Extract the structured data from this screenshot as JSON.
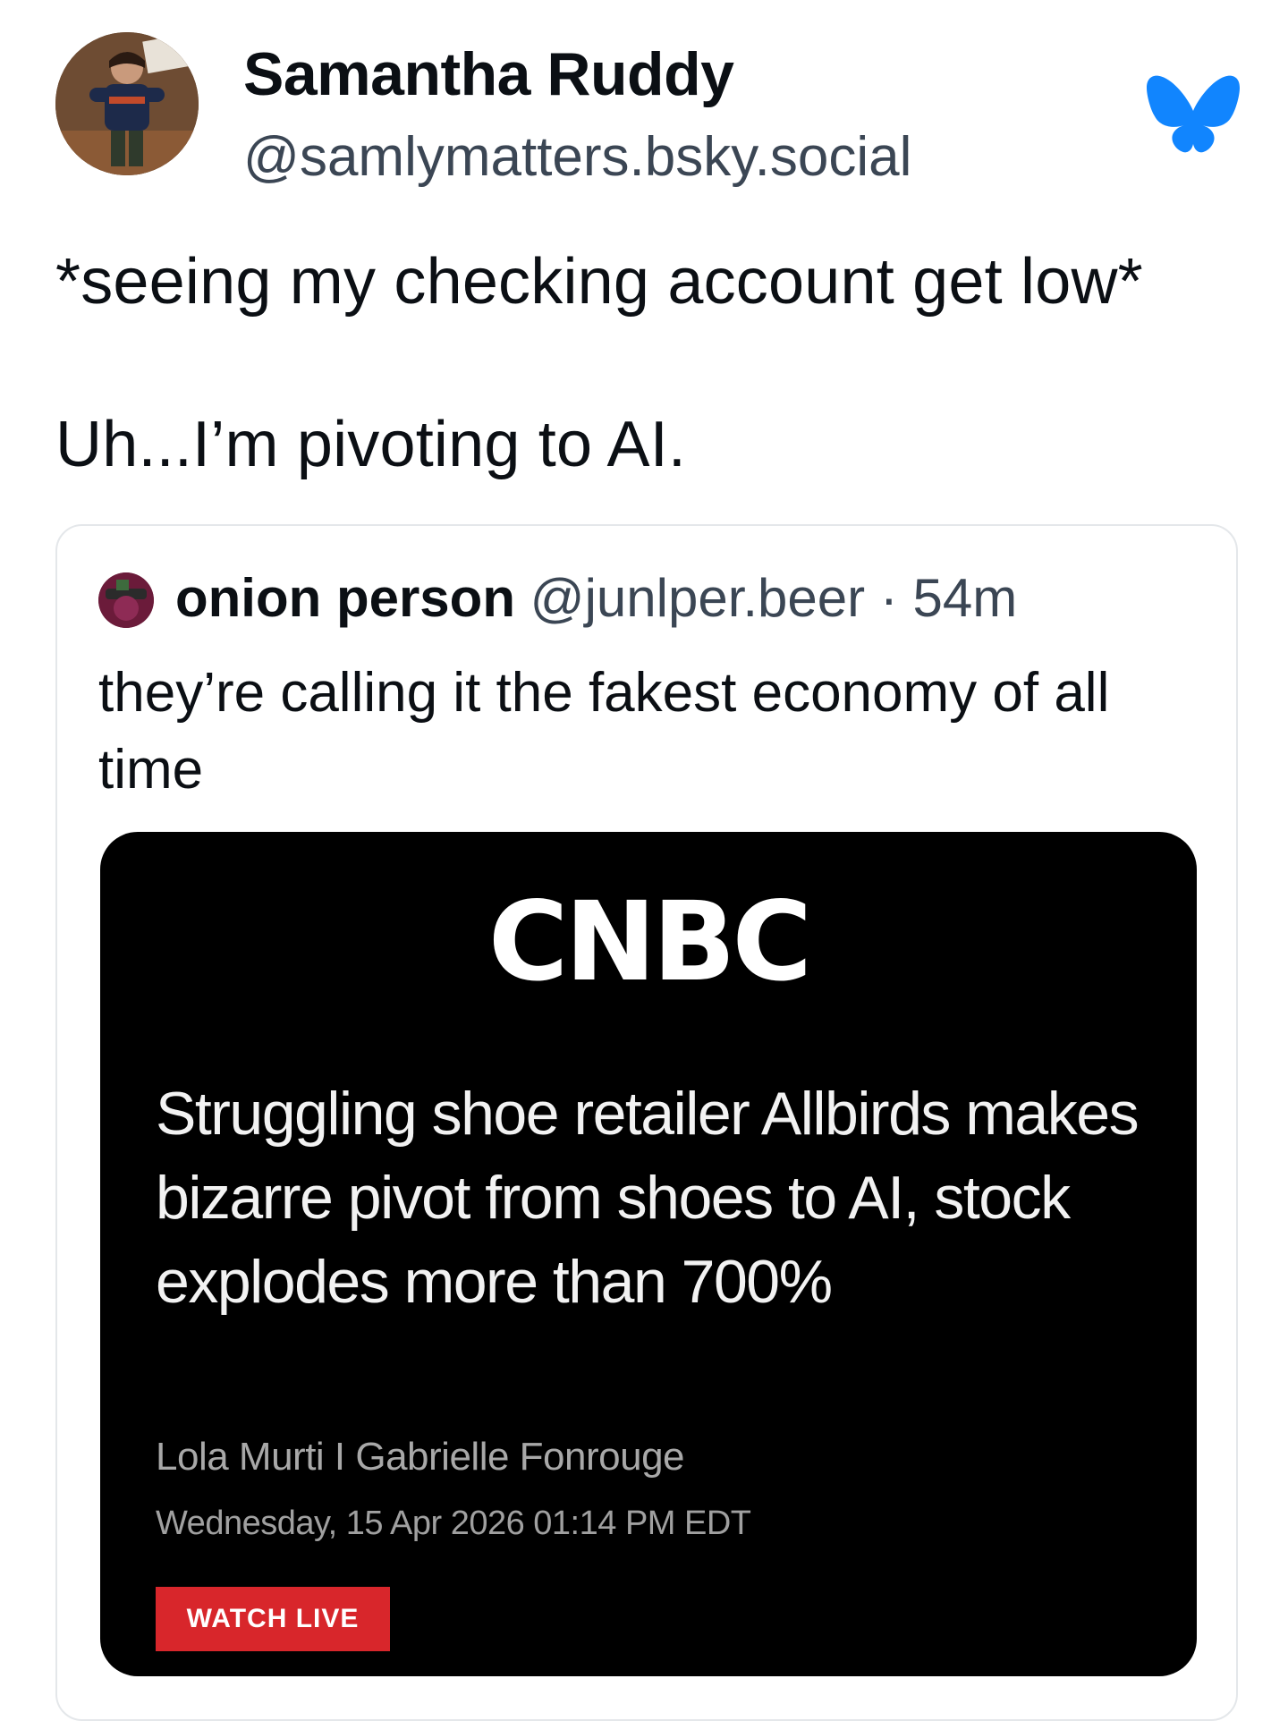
{
  "post": {
    "author": {
      "display_name": "Samantha Ruddy",
      "handle": "@samlymatters.bsky.social",
      "avatar_icon": "profile-photo"
    },
    "platform_icon": "bluesky-butterfly-icon",
    "brand_color": "#1185fe",
    "text_lines": [
      "*seeing my checking account get low*",
      "Uh...I’m pivoting to AI."
    ]
  },
  "quoted_post": {
    "display_name": "onion person",
    "handle": "@junlper.beer",
    "separator": "·",
    "time_ago": "54m",
    "text": "they’re calling it the fakest economy of all time",
    "embed": {
      "logo_text": "CNBC",
      "headline": "Struggling shoe retailer Allbirds makes bizarre pivot from shoes to AI, stock explodes more than 700%",
      "byline": "Lola Murti I Gabrielle Fonrouge",
      "dateline": "Wednesday, 15 Apr 2026 01:14 PM EDT",
      "watch_live_label": "WATCH LIVE",
      "watch_live_color": "#d8262b"
    }
  }
}
